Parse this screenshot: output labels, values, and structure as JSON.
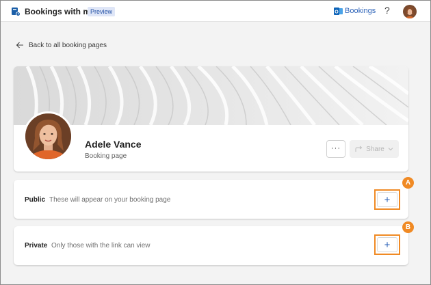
{
  "topbar": {
    "app_title": "Bookings with me",
    "badge": "Preview",
    "bookings_link": "Bookings",
    "help_glyph": "?",
    "icons": [
      "bookings-app-icon",
      "outlook-icon",
      "help-icon",
      "user-avatar"
    ]
  },
  "back_link": {
    "label": "Back to all booking pages",
    "icon": "arrow-left-icon"
  },
  "profile": {
    "name": "Adele Vance",
    "subtitle": "Booking page",
    "more_label": "···",
    "share_label": "Share"
  },
  "sections": [
    {
      "title": "Public",
      "description": "These will appear on your booking page",
      "add_label": "+",
      "callout": "A"
    },
    {
      "title": "Private",
      "description": "Only those with the link can view",
      "add_label": "+",
      "callout": "B"
    }
  ],
  "colors": {
    "accent": "#2b62b8",
    "callout": "#f08a24",
    "background": "#f3f3f3"
  }
}
